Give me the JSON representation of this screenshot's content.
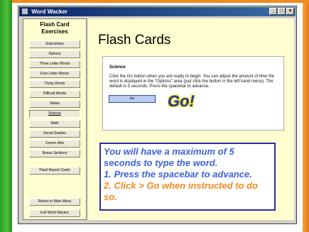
{
  "window": {
    "title": "Word Wacker",
    "title_buttons": [
      "_",
      "□",
      "×"
    ]
  },
  "sidebar": {
    "heading_line1": "Flash Card",
    "heading_line2": "Exercises",
    "items": [
      {
        "label": "Instructions"
      },
      {
        "label": "Options"
      },
      {
        "label": "Three Letter Words"
      },
      {
        "label": "Four Letter Words"
      },
      {
        "label": "Tricky Words"
      },
      {
        "label": "Difficult Words"
      },
      {
        "label": "States"
      },
      {
        "label": "Science",
        "active": true
      },
      {
        "label": "Math"
      },
      {
        "label": "Social Studies"
      },
      {
        "label": "Comm. Arts"
      },
      {
        "label": "Bonus Sections"
      }
    ],
    "report_button": "Flash Report Cards",
    "return_button": "Return to Main Menu",
    "exit_button": "Exit Word Wacker"
  },
  "main": {
    "title": "Flash Cards",
    "section": "Science",
    "instructions": "Click the Go button when you are ready to begin. You can adjust the amount of time the word is displayed in the \"Options\" area (just click the button in the left hand menu). The default is 5 seconds. Press the spacebar to advance.",
    "go_button": "Go",
    "go_graphic": "Go!"
  },
  "callout": {
    "line1": "You will have a maximum of 5 seconds to type the word.",
    "line2": "1.  Press the spacebar to advance.",
    "line3": "2.  Click > Go when instructed to do so."
  },
  "colors": {
    "slide_green": "#3fb02f",
    "slide_orange": "#f08a1c",
    "callout_blue": "#3d63d6"
  }
}
